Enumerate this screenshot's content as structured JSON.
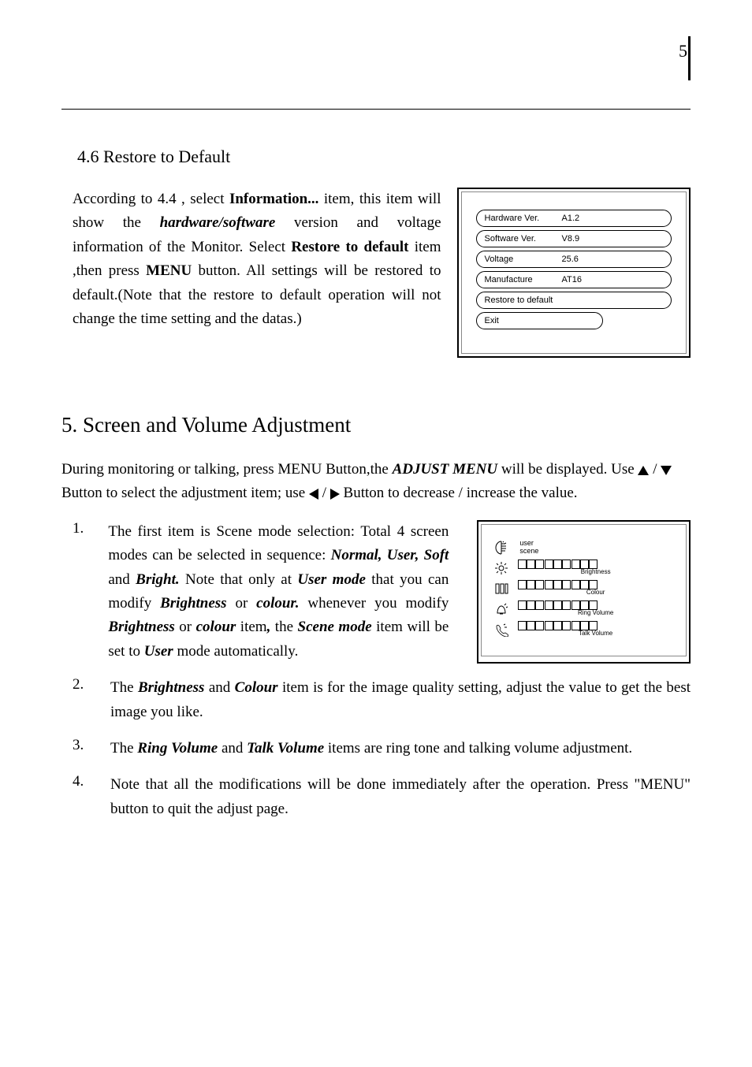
{
  "page_number": "5",
  "section46": {
    "title": "4.6 Restore to Default",
    "p1_a": "According to 4.4 , select ",
    "p1_b": "Information...",
    "p1_c": " item, this item will show the ",
    "p1_d": "hardware/software",
    "p1_e": " version and voltage information of the Monitor. Select ",
    "p1_f": "Restore to default",
    "p1_g": " item ,then press ",
    "p1_h": "MENU",
    "p1_i": " button. All settings will be restored  to default.(Note that the restore to default operation will not change the time setting and the datas.)"
  },
  "info_panel": {
    "rows": [
      {
        "label": "Hardware Ver.",
        "value": "A1.2"
      },
      {
        "label": "Software Ver.",
        "value": "V8.9"
      },
      {
        "label": "Voltage",
        "value": "25.6"
      },
      {
        "label": "Manufacture",
        "value": "AT16"
      },
      {
        "label": "Restore to default",
        "value": ""
      }
    ],
    "exit": "Exit"
  },
  "section5": {
    "heading": "5. Screen and Volume Adjustment",
    "intro_a": "During monitoring or talking, press MENU Button,the ",
    "intro_b": "ADJUST MENU",
    "intro_c": " will be displayed. Use ",
    "intro_d": " / ",
    "intro_e": " Button to select the adjustment item; use ",
    "intro_f": " / ",
    "intro_g": " Button to decrease / increase the value.",
    "items": [
      {
        "num": "1.",
        "a": "The first item is Scene mode selection: Total 4 screen modes can be selected in sequence: ",
        "b": "Normal, User, Soft",
        "c": " and ",
        "d": "Bright.",
        "e": "  Note that only at ",
        "f": "User mode",
        "g": " that you can modify ",
        "h": "Brightness",
        "i": " or ",
        "j": "colour.",
        "k": " whenever you modify ",
        "l": "Brightness",
        "m": " or ",
        "n": "colour",
        "o": " item",
        "p": ",",
        "q": " the ",
        "r": "Scene mode",
        "s": " item will be set to ",
        "t": "User",
        "u": " mode automatically."
      },
      {
        "num": "2.",
        "a": "The ",
        "b": "Brightness",
        "c": " and ",
        "d": "Colour",
        "e": " item is for the image quality setting, adjust the value to get the best image you like."
      },
      {
        "num": "3.",
        "a": "The ",
        "b": "Ring Volume",
        "c": " and ",
        "d": "Talk Volume",
        "e": " items are  ring tone and talking volume adjustment."
      },
      {
        "num": "4.",
        "a": "Note that all the modifications will be done immediately after the operation. Press \"MENU\" button to quit the adjust page."
      }
    ]
  },
  "adjust_panel": {
    "scene_user": "user",
    "scene_label": "scene",
    "bars": [
      {
        "label": "Brightness"
      },
      {
        "label": "Colour"
      },
      {
        "label": "Ring Volume"
      },
      {
        "label": "Talk Volume"
      }
    ]
  }
}
